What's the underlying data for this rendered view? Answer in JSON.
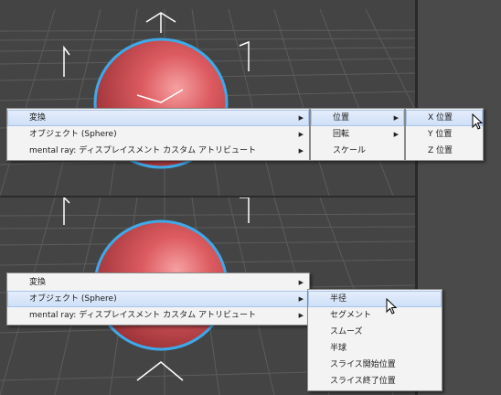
{
  "top_menus": {
    "main": {
      "items": [
        {
          "label": "変換",
          "submenu": true,
          "highlighted": true
        },
        {
          "label": "オブジェクト (Sphere)",
          "submenu": true,
          "highlighted": false
        },
        {
          "label": "mental ray: ディスプレイスメント カスタム アトリビュート",
          "submenu": true,
          "highlighted": false
        }
      ]
    },
    "sub1": {
      "items": [
        {
          "label": "位置",
          "submenu": true,
          "highlighted": true
        },
        {
          "label": "回転",
          "submenu": true,
          "highlighted": false
        },
        {
          "label": "スケール",
          "submenu": false,
          "highlighted": false
        }
      ]
    },
    "sub2": {
      "items": [
        {
          "label": "X 位置",
          "highlighted": true
        },
        {
          "label": "Y 位置",
          "highlighted": false
        },
        {
          "label": "Z 位置",
          "highlighted": false
        }
      ]
    }
  },
  "bottom_menus": {
    "main": {
      "items": [
        {
          "label": "変換",
          "submenu": true,
          "highlighted": false
        },
        {
          "label": "オブジェクト (Sphere)",
          "submenu": true,
          "highlighted": true
        },
        {
          "label": "mental ray: ディスプレイスメント カスタム アトリビュート",
          "submenu": true,
          "highlighted": false
        }
      ]
    },
    "sub1": {
      "items": [
        {
          "label": "半径",
          "highlighted": true
        },
        {
          "label": "セグメント",
          "highlighted": false
        },
        {
          "label": "スムーズ",
          "highlighted": false
        },
        {
          "label": "半球",
          "highlighted": false
        },
        {
          "label": "スライス開始位置",
          "highlighted": false
        },
        {
          "label": "スライス終了位置",
          "highlighted": false
        }
      ]
    }
  },
  "colors": {
    "viewport_bg": "#444444",
    "grid_line": "#5a5a5a",
    "sphere": "#d9555a",
    "selection_outline": "#3fa9e8",
    "menu_bg": "#f3f3f3",
    "highlight": "#cddff7"
  }
}
